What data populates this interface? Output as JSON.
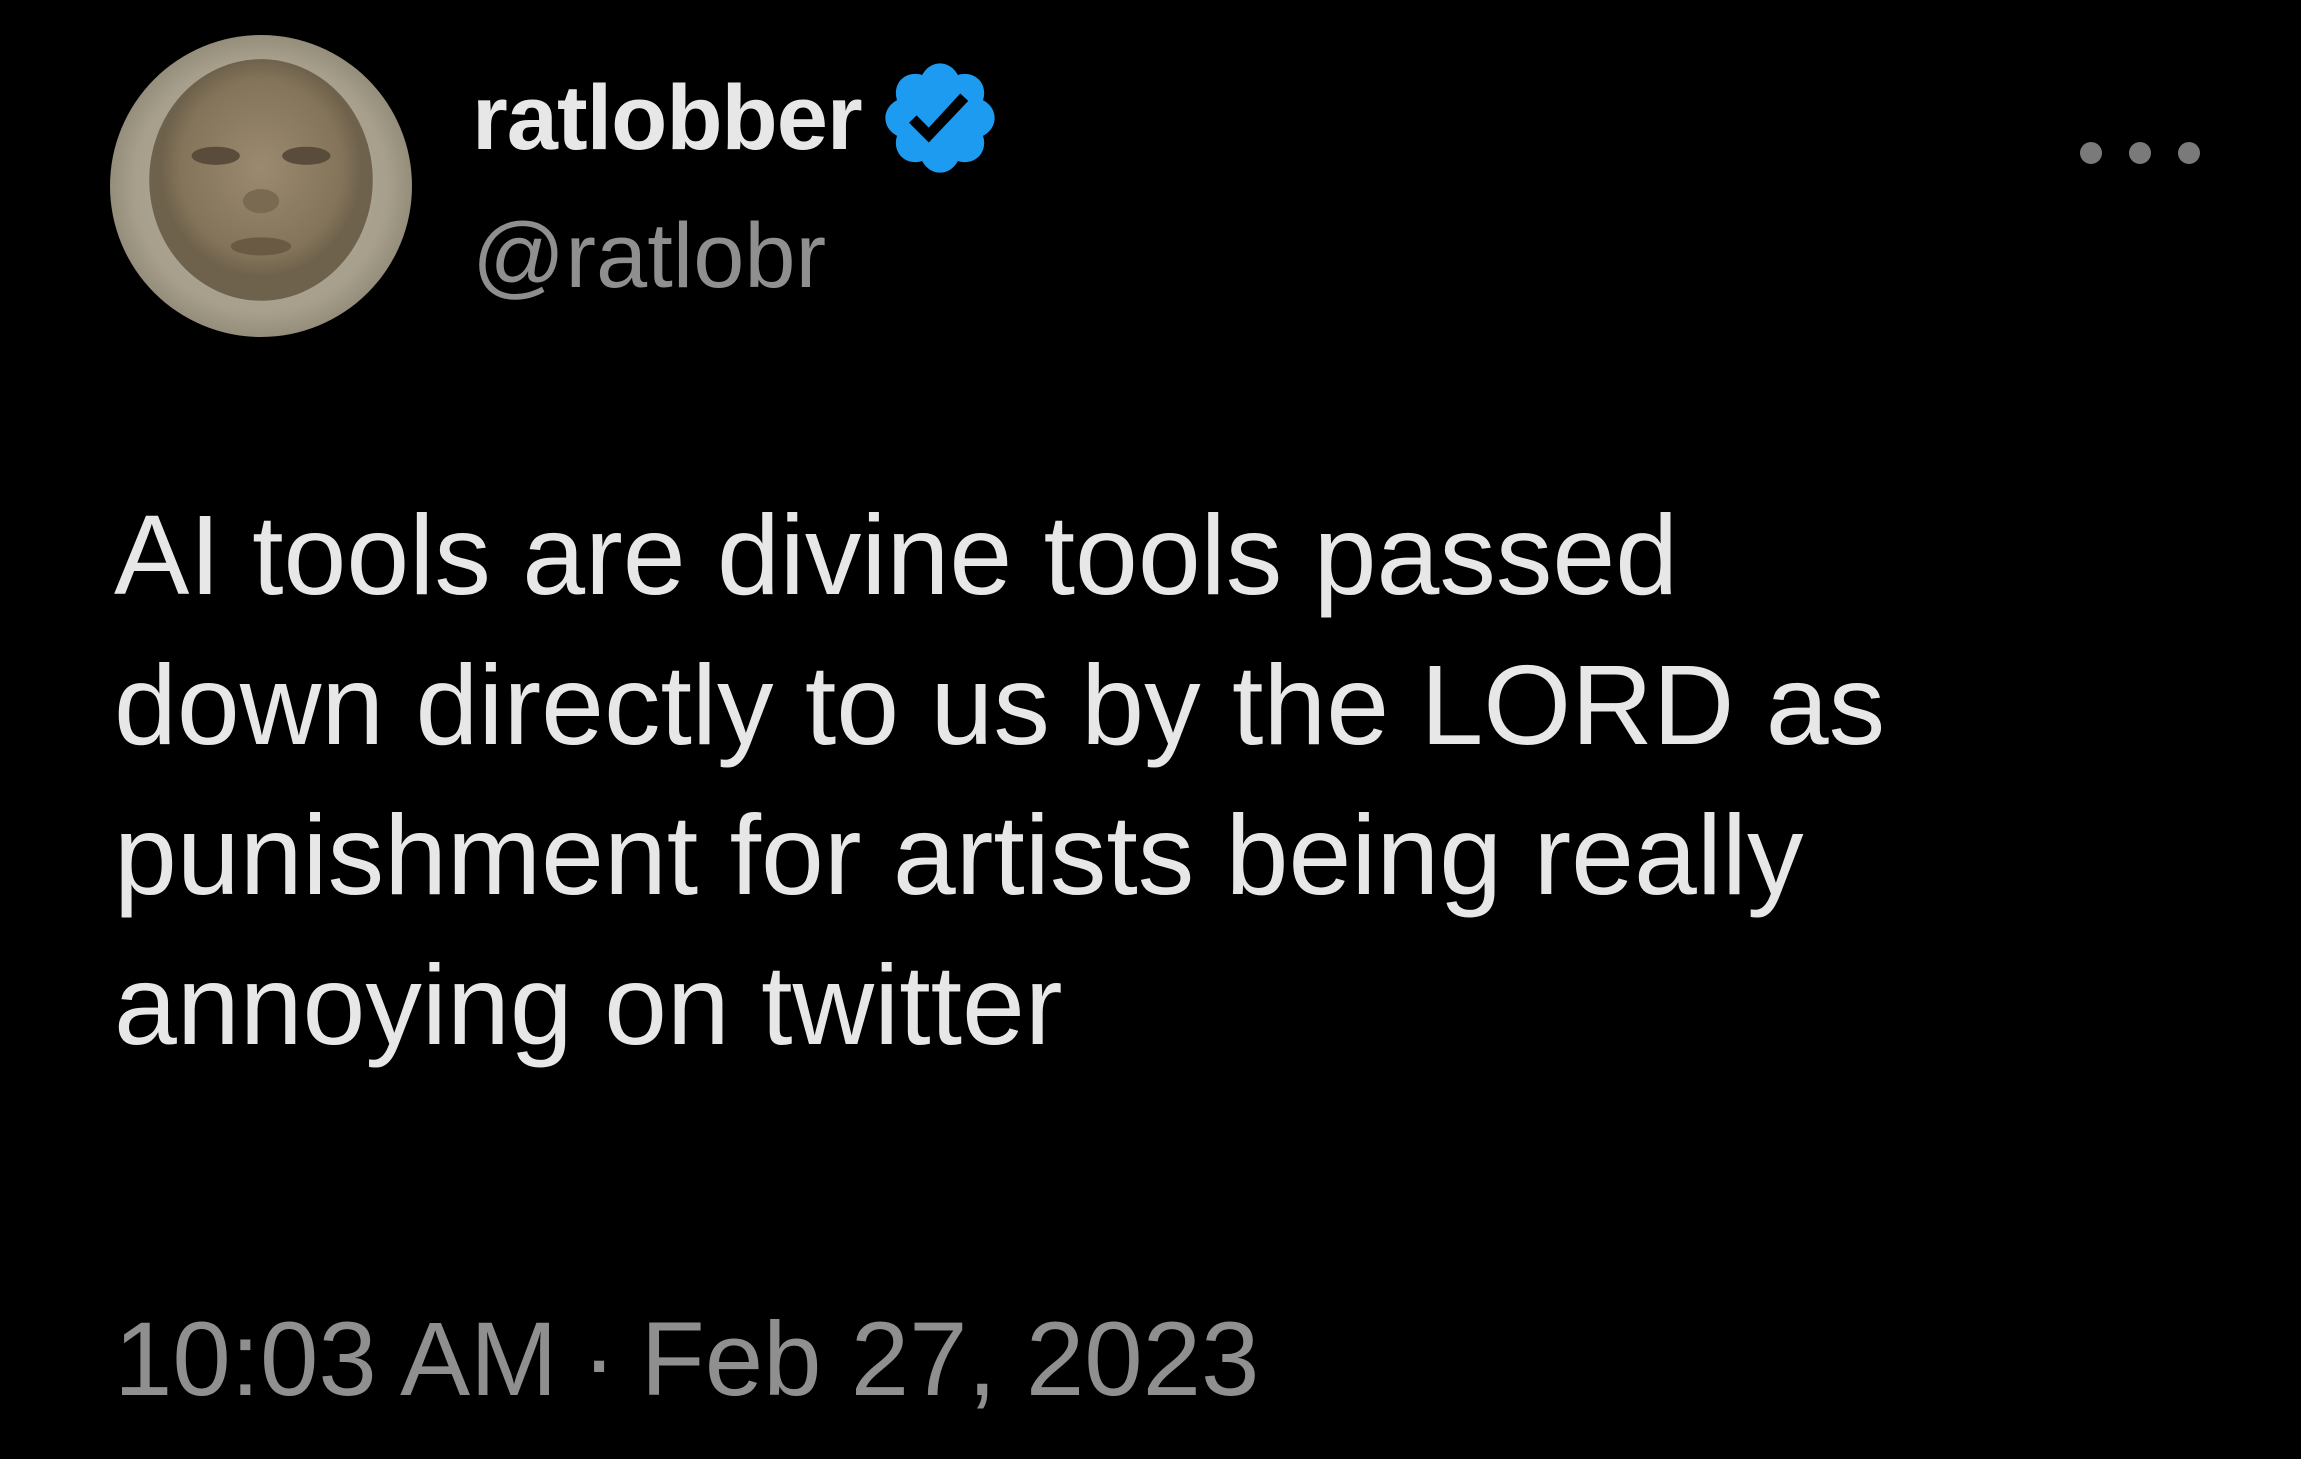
{
  "author": {
    "display_name": "ratlobber",
    "handle": "@ratlobr",
    "verified": true,
    "avatar_icon": "avatar-photo-face"
  },
  "more_menu_icon": "ellipsis-icon",
  "tweet": {
    "lines": [
      "AI tools are divine tools passed",
      "down directly to us by the LORD as",
      "punishment for artists being really",
      "annoying on twitter"
    ]
  },
  "meta": {
    "time": "10:03 AM",
    "separator": "·",
    "date": "Feb 27, 2023"
  },
  "colors": {
    "background": "#000000",
    "text_primary": "#e7e7e7",
    "text_secondary": "#8f8f8f",
    "verified_badge": "#1d9bf0"
  }
}
